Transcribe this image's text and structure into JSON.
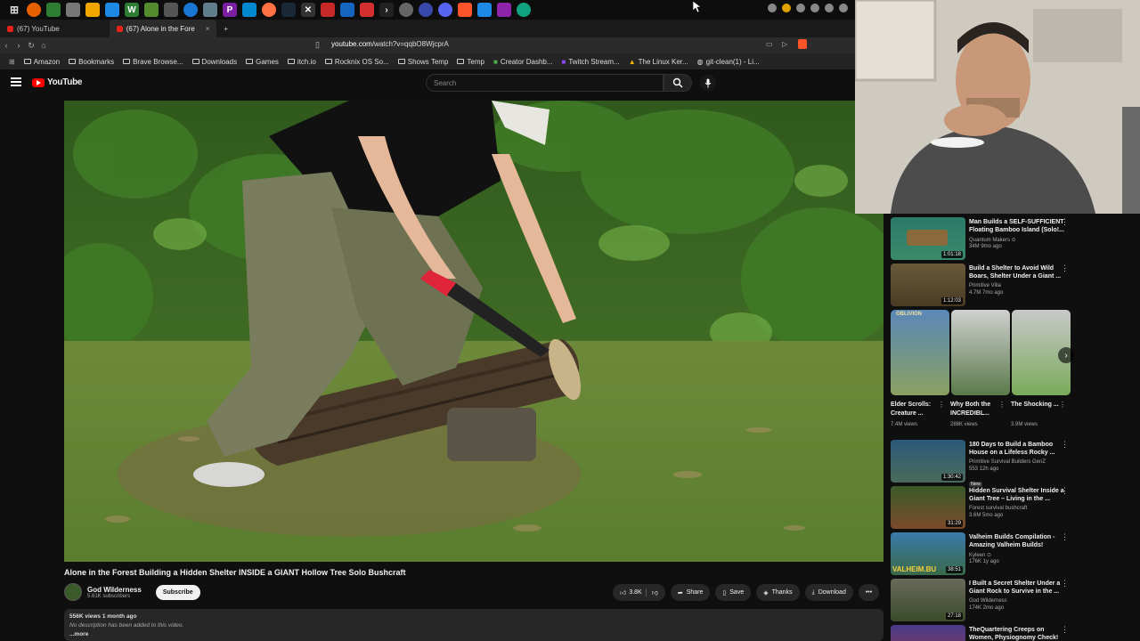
{
  "browser": {
    "tabs": [
      {
        "label": "(67) YouTube"
      },
      {
        "label": "(67) Alone in the Fore",
        "close": "×"
      }
    ],
    "new_tab": "+",
    "url_host": "youtube.com",
    "url_path": "/watch?v=qqbO8WjcprA",
    "bookmarks": [
      "Amazon",
      "Bookmarks",
      "Brave Browse...",
      "Downloads",
      "Games",
      "itch.io",
      "Rocknix OS So...",
      "Shows Temp",
      "Temp",
      "Creator Dashb...",
      "Twitch Stream...",
      "The Linux Ker...",
      "git-clean(1) - Li..."
    ]
  },
  "youtube": {
    "logo_text": "YouTube",
    "search_placeholder": "Search"
  },
  "video": {
    "title": "Alone in the Forest Building a Hidden Shelter INSIDE a GIANT Hollow Tree Solo Bushcraft",
    "channel": "God Wilderness",
    "subscribers": "5.61K subscribers",
    "subscribe_label": "Subscribe",
    "likes": "3.8K",
    "share_label": "Share",
    "save_label": "Save",
    "thanks_label": "Thanks",
    "download_label": "Download",
    "more_label": "•••",
    "views_line": "556K views  1 month ago",
    "description": "No description has been added to this video.",
    "more_link": "...more"
  },
  "recommendations_top": [
    {
      "title": "Man Builds a SELF-SUFFICIENT Floating Bamboo Island (Solo!...",
      "channel": "Quantum Makers ⊙",
      "meta": "34M  9mo ago",
      "duration": "1:01:18"
    },
    {
      "title": "Build a Shelter to Avoid Wild Boars, Shelter Under a Giant ...",
      "channel": "Primitive Villa",
      "meta": "4.7M  7mo ago",
      "duration": "1:12:03"
    }
  ],
  "shorts": [
    {
      "title": "Elder Scrolls: Creature ...",
      "views": "7.4M views",
      "badge": "OBLIVION"
    },
    {
      "title": "Why Both the INCREDIBL...",
      "views": "288K views"
    },
    {
      "title": "The Shocking ...",
      "views": "3.9M views"
    }
  ],
  "shelf_next": "›",
  "recommendations_bottom": [
    {
      "title": "180 Days to Build a Bamboo House on a Lifeless Rocky ...",
      "channel": "Primitive Survival Builders GenZ",
      "meta": "553  12h ago",
      "duration": "1:30:42",
      "badge": "New"
    },
    {
      "title": "Hidden Survival Shelter Inside a Giant Tree – Living in the ...",
      "channel": "Forest survival bushcraft",
      "meta": "3.6M  5mo ago",
      "duration": "31:29"
    },
    {
      "title": "Valheim Builds Compilation - Amazing Valheim Builds!",
      "channel": "Kyleen ⊙",
      "meta": "176K  1y ago",
      "duration": "38:51",
      "overlay": "VALHEIM.BU"
    },
    {
      "title": "I Built a Secret Shelter Under a Giant Rock to Survive in the ...",
      "channel": "God Wilderness",
      "meta": "174K  2mo ago",
      "duration": "27:18"
    },
    {
      "title": "TheQuartering Creeps on Women, Physiognomy Check!",
      "channel": "",
      "meta": "",
      "duration": ""
    }
  ],
  "colors": {
    "yt_red": "#ff0000",
    "bg": "#0f0f0f",
    "pill": "#272727"
  }
}
